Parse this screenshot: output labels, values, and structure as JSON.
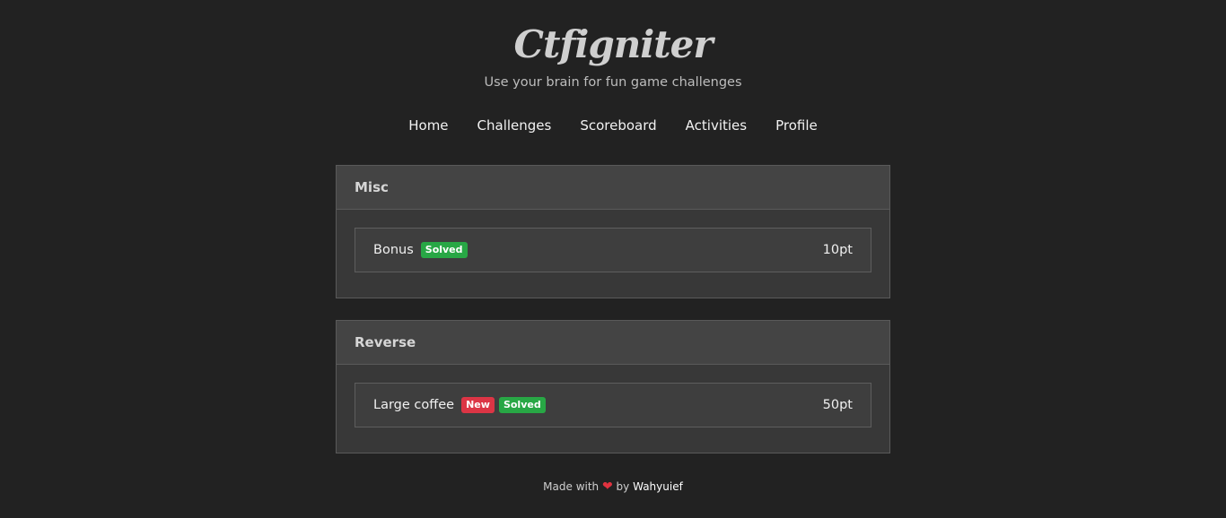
{
  "site": {
    "brand": "Ctfigniter",
    "tagline": "Use your brain for fun game challenges"
  },
  "nav": {
    "items": [
      {
        "label": "Home"
      },
      {
        "label": "Challenges"
      },
      {
        "label": "Scoreboard"
      },
      {
        "label": "Activities"
      },
      {
        "label": "Profile"
      }
    ]
  },
  "categories": [
    {
      "name": "Misc",
      "challenges": [
        {
          "name": "Bonus",
          "badges": [
            "Solved"
          ],
          "points": "10pt"
        }
      ]
    },
    {
      "name": "Reverse",
      "challenges": [
        {
          "name": "Large coffee",
          "badges": [
            "New",
            "Solved"
          ],
          "points": "50pt"
        }
      ]
    }
  ],
  "footer": {
    "made_with": "Made with",
    "by": "by",
    "author": "Wahyuief"
  },
  "colors": {
    "solved_badge": "#28a745",
    "new_badge": "#dc3545",
    "heart": "#e0323f"
  }
}
